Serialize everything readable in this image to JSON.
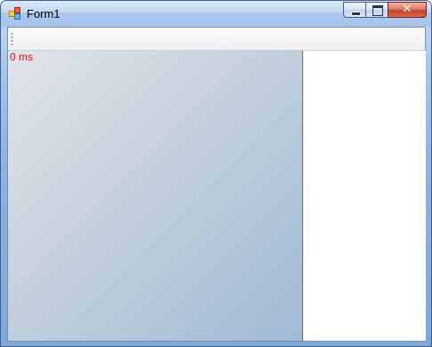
{
  "window": {
    "title": "Form1"
  },
  "caption_buttons": {
    "minimize_icon": "minimize-icon",
    "maximize_icon": "maximize-icon",
    "close_icon": "close-icon",
    "close_glyph": "✕"
  },
  "canvas": {
    "timing_text": "0 ms",
    "timing_color": "#ff0000"
  }
}
